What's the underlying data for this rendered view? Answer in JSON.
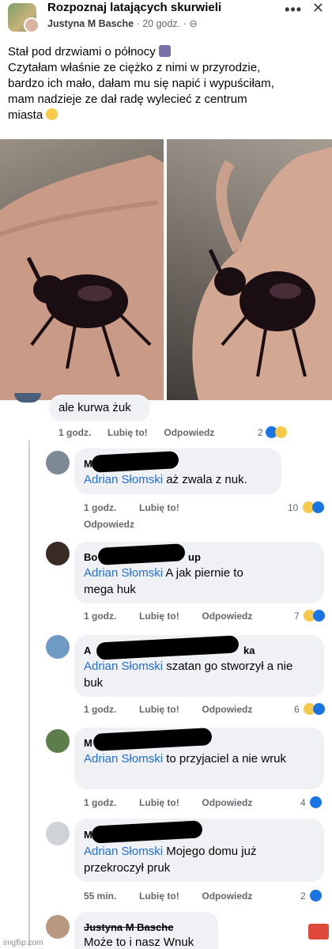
{
  "post": {
    "group_name": "Rozpoznaj latających skurwieli",
    "author": "Justyna M Basche",
    "time": "20 godz.",
    "privacy_icon": "globe-icon",
    "more_icon": "more-horizontal-icon",
    "close_icon": "close-icon",
    "text_lines": [
      "Stał pod drzwiami o północy",
      "Czytałam właśnie ze ciężko z nimi w przyrodzie,",
      "bardzo ich mało, dałam mu się napić i wypuściłam,",
      "mam nadzieje ze dał radę wylecieć z centrum",
      "miasta"
    ]
  },
  "top_comment": {
    "text": "ale kurwa żuk",
    "time": "1 godz.",
    "like": "Lubię to!",
    "reply": "Odpowiedz",
    "reactions": "2"
  },
  "replies": [
    {
      "name_visible": "M",
      "mention": "Adrian Słomski",
      "text": " aż zwala z nuk.",
      "time": "1 godz.",
      "like": "Lubię to!",
      "reply": "Odpowiedz",
      "reactions": "10"
    },
    {
      "name_visible": "Bo",
      "name_tail": "up",
      "mention": "Adrian Słomski",
      "text": " A jak piernie to mega huk",
      "time": "1 godz.",
      "like": "Lubię to!",
      "reply": "Odpowiedz",
      "reactions": "7"
    },
    {
      "name_visible": "A",
      "name_tail": "ka",
      "mention": "Adrian Słomski",
      "text": " szatan go stworzył a nie buk",
      "time": "1 godz.",
      "like": "Lubię to!",
      "reply": "Odpowiedz",
      "reactions": "6"
    },
    {
      "name_visible": "M",
      "mention": "Adrian Słomski",
      "text": " to przyjaciel a nie wruk",
      "time": "1 godz.",
      "like": "Lubię to!",
      "reply": "Odpowiedz",
      "reactions": "4"
    },
    {
      "name_visible": "M",
      "mention": "Adrian Słomski",
      "text": " Mojego domu już przekroczył pruk",
      "time": "55 min.",
      "like": "Lubię to!",
      "reply": "Odpowiedz",
      "reactions": "2"
    },
    {
      "name_visible": "Justyna M Basche",
      "text": "Może to i nasz Wnuk"
    }
  ],
  "watermark": "imgflip.com",
  "colors": {
    "mention": "#216fdb",
    "bubble": "#eff1f4",
    "like": "#1b74e4",
    "haha": "#f7c94a"
  }
}
